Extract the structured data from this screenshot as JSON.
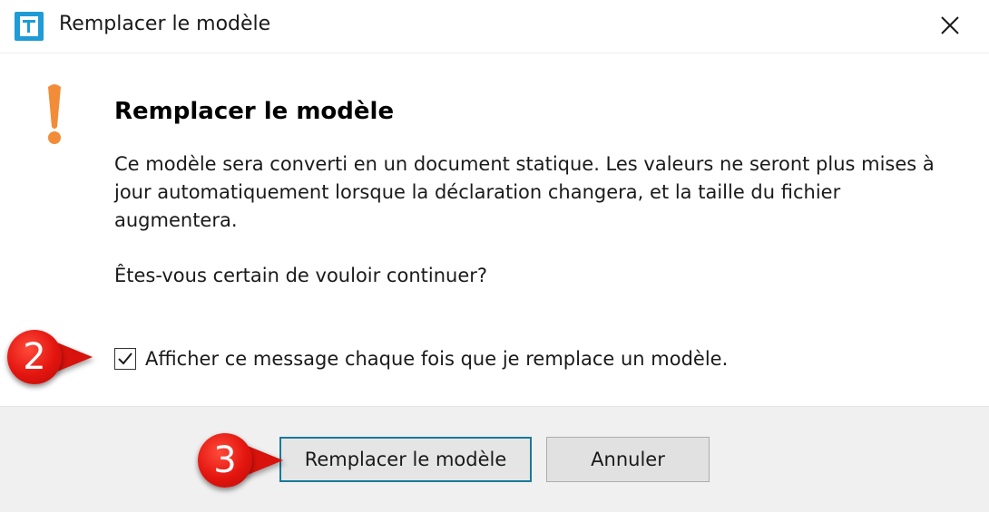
{
  "window": {
    "title": "Remplacer le modèle",
    "app_icon": "app-logo-icon",
    "close_icon": "close-icon"
  },
  "dialog": {
    "icon": "warning-exclamation-icon",
    "heading": "Remplacer le modèle",
    "message": "Ce modèle sera converti en un document statique. Les valeurs ne seront plus mises à jour automatiquement lorsque la déclaration changera, et la taille du fichier augmentera.",
    "question": "Êtes-vous certain de vouloir continuer?",
    "checkbox": {
      "label": "Afficher ce message chaque fois que je remplace un modèle.",
      "checked": true
    }
  },
  "buttons": {
    "confirm_label": "Remplacer le modèle",
    "cancel_label": "Annuler"
  },
  "annotations": {
    "step_2": "2",
    "step_3": "3"
  },
  "colors": {
    "warning": "#f28c38",
    "app_icon": "#1f9bd6",
    "primary_border": "#1a7a9a",
    "badge": "#e3150f",
    "footer": "#f0f0f0"
  }
}
